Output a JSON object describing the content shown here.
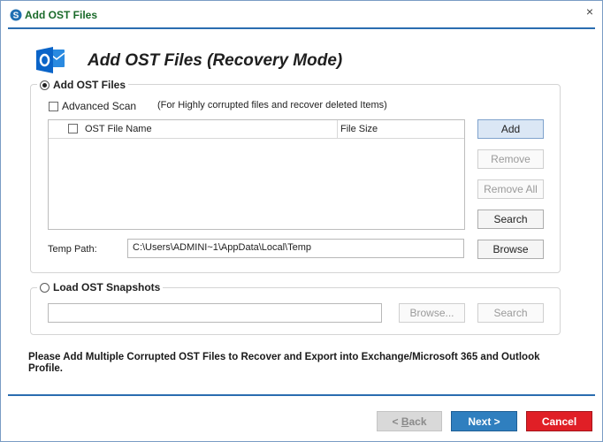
{
  "window": {
    "title": "Add OST Files",
    "close_symbol": "×"
  },
  "header": {
    "title": "Add OST Files (Recovery Mode)",
    "logo_icon": "outlook-icon"
  },
  "add_group": {
    "legend": "Add OST Files",
    "selected": true,
    "advanced_scan": {
      "label": "Advanced Scan",
      "checked": false,
      "note": "(For Highly corrupted files and recover deleted Items)"
    },
    "file_list": {
      "columns": [
        "OST File Name",
        "File Size"
      ],
      "rows": []
    },
    "buttons": {
      "add": "Add",
      "remove": "Remove",
      "remove_all": "Remove All",
      "search": "Search",
      "browse": "Browse"
    },
    "temp_path": {
      "label": "Temp Path:",
      "value": "C:\\Users\\ADMINI~1\\AppData\\Local\\Temp"
    }
  },
  "snapshot_group": {
    "legend": "Load OST Snapshots",
    "selected": false,
    "path_value": "",
    "buttons": {
      "browse": "Browse...",
      "search": "Search"
    }
  },
  "notice": "Please Add Multiple Corrupted OST Files to Recover and Export into Exchange/Microsoft 365 and Outlook Profile.",
  "footer": {
    "back_mnemonic": "B",
    "back_rest": "ack",
    "back_prefix": "< ",
    "next": "Next >",
    "cancel": "Cancel"
  },
  "colors": {
    "accent": "#2a6db0",
    "next_button": "#2f7fbf",
    "cancel_button": "#e01f26",
    "title_text": "#1a6a2a",
    "outlook_blue": "#0a64c8"
  }
}
